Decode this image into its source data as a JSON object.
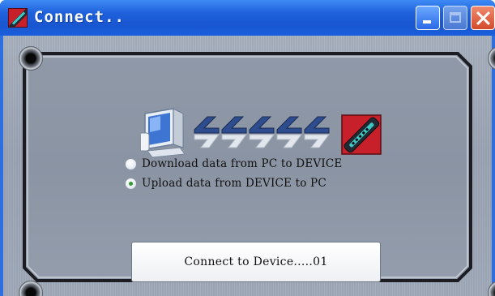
{
  "window": {
    "title": "Connect..",
    "icon": "usb-cable-icon",
    "controls": [
      "minimize-icon",
      "maximize-icon",
      "close-icon"
    ]
  },
  "graphic": {
    "left_icon": "pc-monitor-icon",
    "right_icon": "usb-device-icon"
  },
  "options": [
    {
      "label": "Download data from PC to DEVICE",
      "selected": false
    },
    {
      "label": "Upload data from DEVICE to PC",
      "selected": true
    }
  ],
  "connect_button": {
    "label": "Connect to Device.....01"
  },
  "colors": {
    "titlebar": "#1f62dc",
    "panel": "#9aa4b3",
    "close_button": "#d24a2a",
    "device_red": "#c8202a"
  }
}
